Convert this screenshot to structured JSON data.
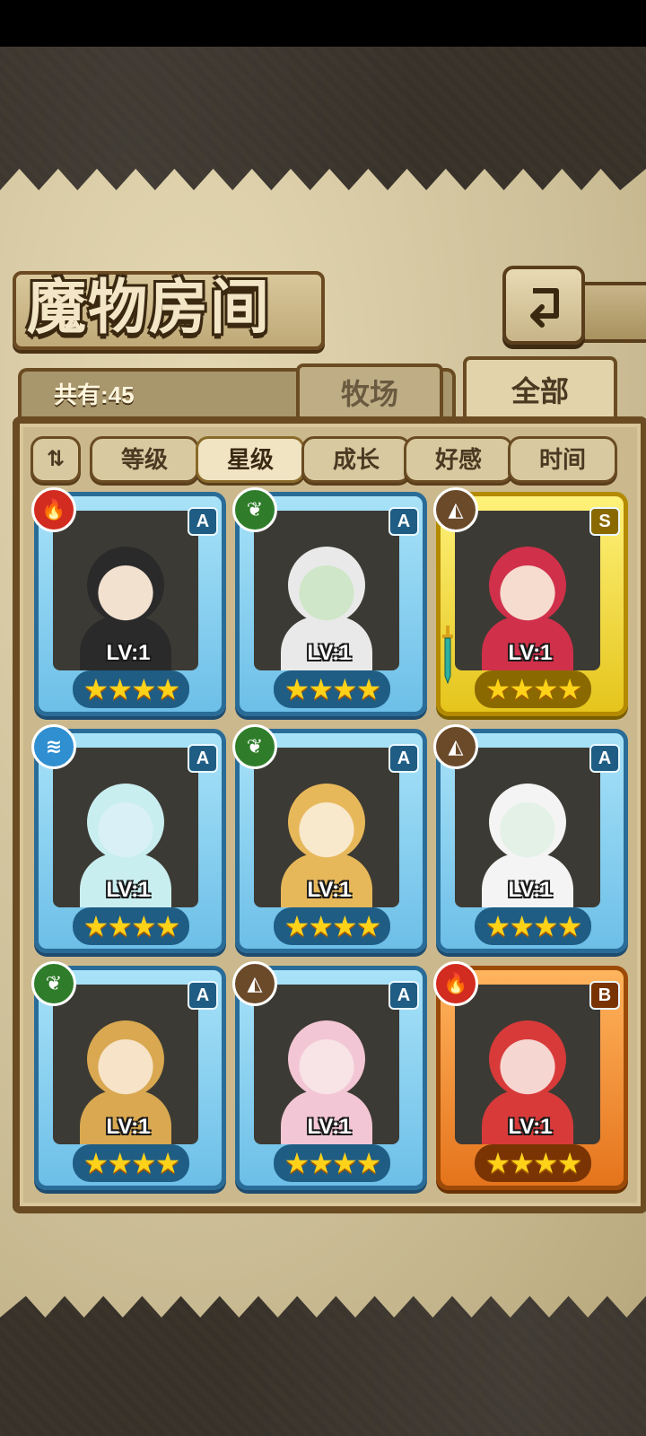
{
  "title": "魔物房间",
  "count_label": "共有:45",
  "tabs": [
    {
      "label": "牧场"
    },
    {
      "label": "全部"
    }
  ],
  "filters": {
    "sort_toggle": "⇅",
    "items": [
      "等级",
      "星级",
      "成长",
      "好感",
      "时间"
    ],
    "active": "星级"
  },
  "colors": {
    "fire": "#d22b1f",
    "nature": "#2f7d2a",
    "earth": "#6b4a2a",
    "water": "#2f8fd0"
  },
  "monsters": [
    {
      "element": "fire",
      "element_icon": "🔥",
      "rank": "A",
      "level": "LV:1",
      "stars": "★★★★",
      "frame": "blue"
    },
    {
      "element": "nature",
      "element_icon": "❦",
      "rank": "A",
      "level": "LV:1",
      "stars": "★★★★",
      "frame": "blue"
    },
    {
      "element": "earth",
      "element_icon": "◭",
      "rank": "S",
      "level": "LV:1",
      "stars": "★★★★",
      "frame": "gold"
    },
    {
      "element": "water",
      "element_icon": "≋",
      "rank": "A",
      "level": "LV:1",
      "stars": "★★★★",
      "frame": "blue"
    },
    {
      "element": "nature",
      "element_icon": "❦",
      "rank": "A",
      "level": "LV:1",
      "stars": "★★★★",
      "frame": "blue"
    },
    {
      "element": "earth",
      "element_icon": "◭",
      "rank": "A",
      "level": "LV:1",
      "stars": "★★★★",
      "frame": "blue"
    },
    {
      "element": "nature",
      "element_icon": "❦",
      "rank": "A",
      "level": "LV:1",
      "stars": "★★★★",
      "frame": "blue"
    },
    {
      "element": "earth",
      "element_icon": "◭",
      "rank": "A",
      "level": "LV:1",
      "stars": "★★★★",
      "frame": "blue"
    },
    {
      "element": "fire",
      "element_icon": "🔥",
      "rank": "B",
      "level": "LV:1",
      "stars": "★★★★",
      "frame": "orange"
    }
  ]
}
